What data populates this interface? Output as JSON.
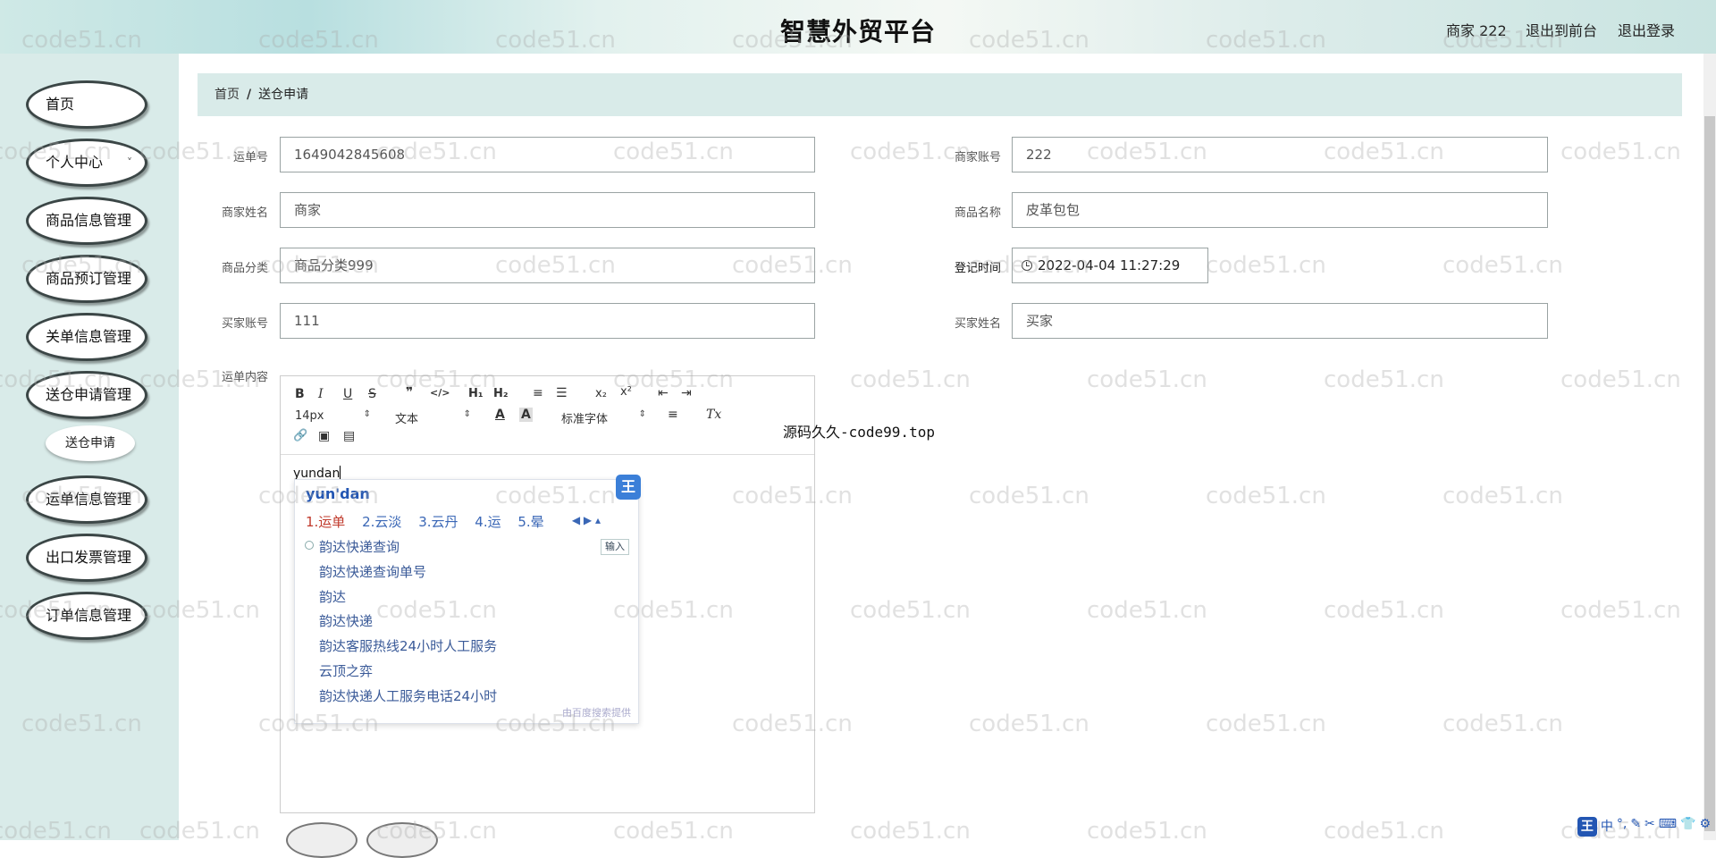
{
  "header": {
    "title": "智慧外贸平台",
    "user": "商家 222",
    "to_front": "退出到前台",
    "logout": "退出登录"
  },
  "sidebar": {
    "items": [
      {
        "label": "首页"
      },
      {
        "label": "个人中心",
        "chevron": "˅"
      },
      {
        "label": "商品信息管理"
      },
      {
        "label": "商品预订管理"
      },
      {
        "label": "关单信息管理"
      },
      {
        "label": "送仓申请管理"
      },
      {
        "label": "运单信息管理"
      },
      {
        "label": "出口发票管理"
      },
      {
        "label": "订单信息管理"
      }
    ],
    "sub_item": "送仓申请"
  },
  "breadcrumb": {
    "home": "首页",
    "sep": "/",
    "current": "送仓申请"
  },
  "form": {
    "waybill_no_label": "运单号",
    "waybill_no": "1649042845608",
    "merchant_account_label": "商家账号",
    "merchant_account": "222",
    "merchant_name_label": "商家姓名",
    "merchant_name": "商家",
    "product_name_label": "商品名称",
    "product_name": "皮革包包",
    "category_label": "商品分类",
    "category": "商品分类999",
    "reg_time_label": "登记时间",
    "reg_time": "2022-04-04 11:27:29",
    "buyer_account_label": "买家账号",
    "buyer_account": "111",
    "buyer_name_label": "买家姓名",
    "buyer_name": "买家",
    "content_label": "运单内容"
  },
  "editor": {
    "toolbar": {
      "bold": "B",
      "italic": "I",
      "underline": "U",
      "strike": "S",
      "quote": "❞",
      "code": "</>",
      "h1": "H₁",
      "h2": "H₂",
      "ol": "≡",
      "ul": "☰",
      "sub": "x₂",
      "sup": "x²",
      "outdent": "⇤",
      "indent": "⇥",
      "size": "14px",
      "text": "文本",
      "color": "A",
      "bg": "A",
      "font": "标准字体",
      "align": "≡",
      "clear": "Tx",
      "link": "🔗",
      "image": "▣",
      "video": "▤"
    },
    "content": "yundan"
  },
  "ime": {
    "pinyin": "yun'dan",
    "logo": "王",
    "candidates": [
      "1.运单",
      "2.云淡",
      "3.云丹",
      "4.运",
      "5.晕"
    ],
    "input_button": "输入",
    "suggestions": [
      "韵达快递查询",
      "韵达快递查询单号",
      "韵达",
      "韵达快递",
      "韵达客服热线24小时人工服务",
      "云顶之弈",
      "韵达快递人工服务电话24小时"
    ],
    "footer": "由百度搜索提供"
  },
  "overlay_text": "源码久久-code99.top",
  "watermark": "code51.cn",
  "imebar": [
    "王",
    "中",
    "°,",
    "✎",
    "✂",
    "⌨",
    "👕",
    "⚙"
  ]
}
